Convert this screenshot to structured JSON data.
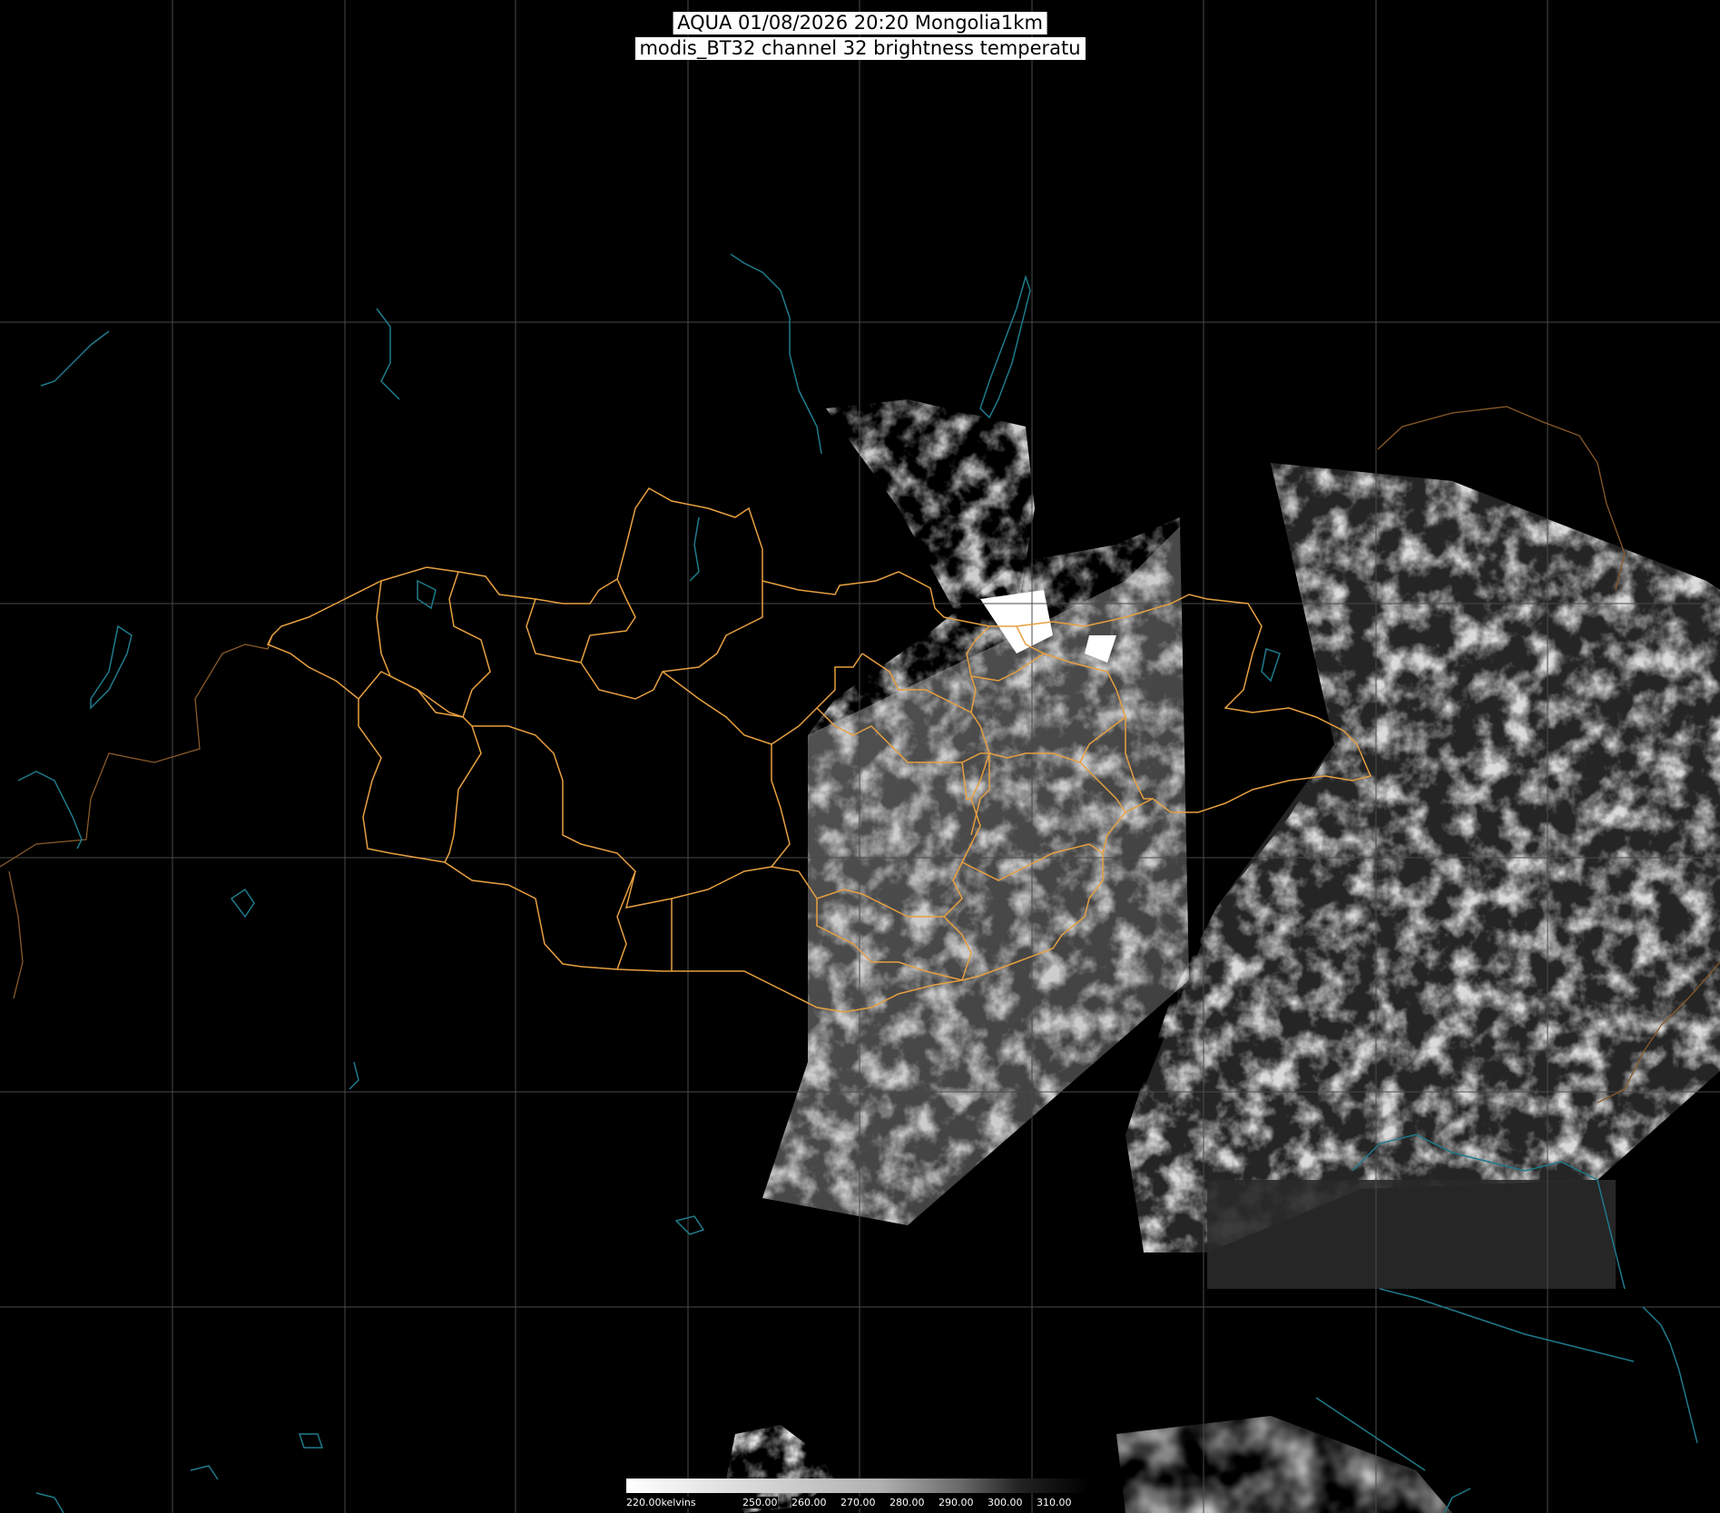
{
  "title": {
    "line1": "AQUA 01/08/2026 20:20 Mongolia1km",
    "line2": "modis_BT32 channel 32 brightness temperatu"
  },
  "colorbar": {
    "unit_label": "220.00kelvins",
    "ticks": [
      "250.00",
      "260.00",
      "270.00",
      "280.00",
      "290.00",
      "300.00",
      "310.00"
    ],
    "scale": "white (cold) to black (warm)"
  },
  "colors": {
    "background": "#000000",
    "graticule": "#4a4a4a",
    "admin_borders": "#e8a040",
    "country_borders": "#8a5a2a",
    "water_features": "#1f7a8c",
    "cloud_light": "#c8c8c8",
    "cloud_dark": "#555555"
  },
  "layers": [
    "graticule",
    "brightness-temperature-swath",
    "admin-boundaries",
    "country-boundaries",
    "rivers-lakes",
    "title",
    "colorbar"
  ]
}
